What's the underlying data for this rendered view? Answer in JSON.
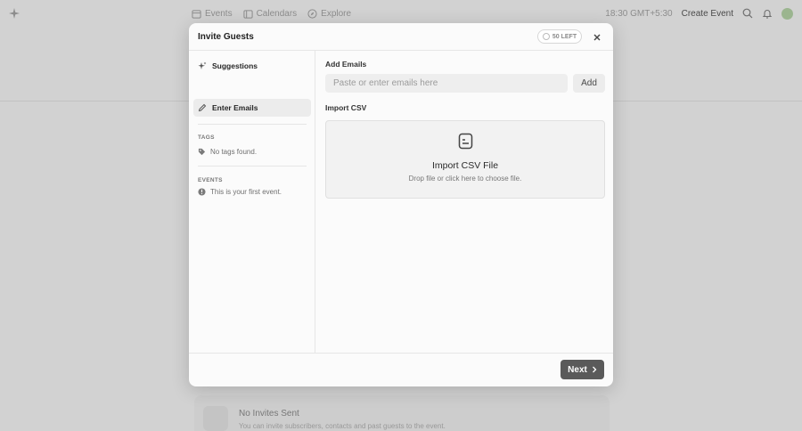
{
  "background": {
    "nav": [
      {
        "label": "Events",
        "icon": "calendar-icon"
      },
      {
        "label": "Calendars",
        "icon": "calendars-icon"
      },
      {
        "label": "Explore",
        "icon": "compass-icon"
      }
    ],
    "time": "18:30 GMT+5:30",
    "create_event": "Create Event",
    "empty_title": "No Invites Sent",
    "empty_sub": "You can invite subscribers, contacts and past guests to the event."
  },
  "modal": {
    "title": "Invite Guests",
    "left_badge": "50 LEFT",
    "close_icon": "close-icon",
    "sidebar": {
      "items": [
        {
          "label": "Suggestions",
          "icon": "sparkle-icon",
          "active": false
        },
        {
          "label": "Enter Emails",
          "icon": "pencil-icon",
          "active": true
        }
      ],
      "tags_header": "TAGS",
      "tags_note": "No tags found.",
      "events_header": "EVENTS",
      "events_note": "This is your first event."
    },
    "main": {
      "add_emails_label": "Add Emails",
      "email_placeholder": "Paste or enter emails here",
      "email_value": "",
      "add_button": "Add",
      "import_csv_label": "Import CSV",
      "drop_title": "Import CSV File",
      "drop_sub": "Drop file or click here to choose file."
    },
    "footer": {
      "next_button": "Next"
    }
  }
}
